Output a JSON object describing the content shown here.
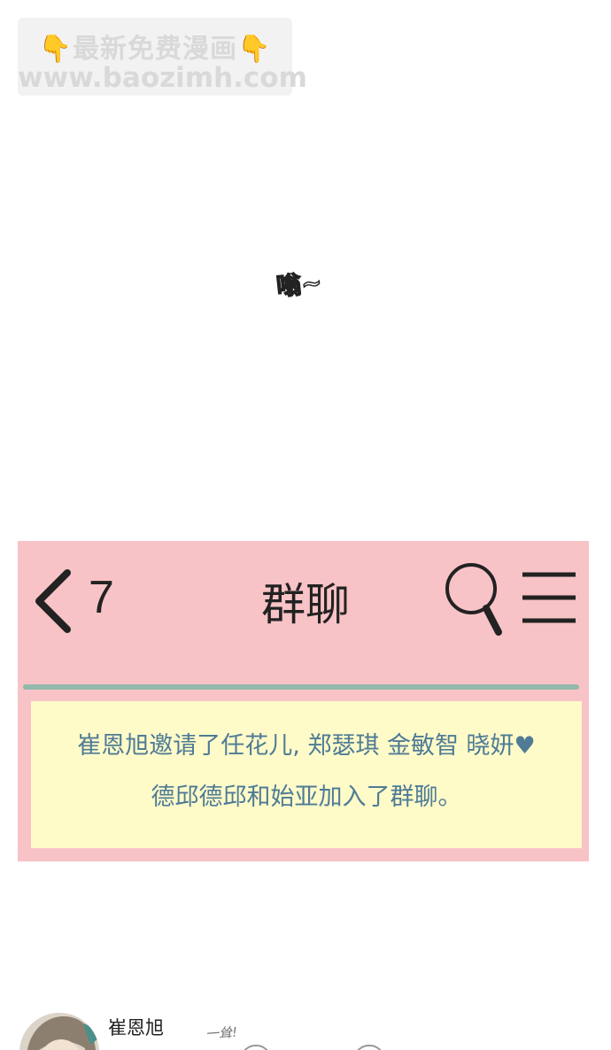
{
  "watermark": {
    "line1_emoji": "👇",
    "line1_text": "最新免费漫画",
    "line2": "www.baozimh.com"
  },
  "sfx": {
    "top": "嗡~"
  },
  "chat": {
    "unread_count": "7",
    "title": "群聊",
    "icons": {
      "back": "chevron-left-icon",
      "search": "search-icon",
      "menu": "hamburger-menu-icon"
    },
    "notice_line1": "崔恩旭邀请了任花儿, 郑瑟琪 金敏智 晓妍♥",
    "notice_line2": "德邱德邱和始亚加入了群聊。"
  },
  "message": {
    "sender": "崔恩旭",
    "sfx": "一耸!"
  },
  "colors": {
    "panel_bg": "#f8c3c6",
    "notice_bg": "#fefbc9",
    "notice_text": "#4f7b95",
    "divider": "#93b8ac"
  }
}
